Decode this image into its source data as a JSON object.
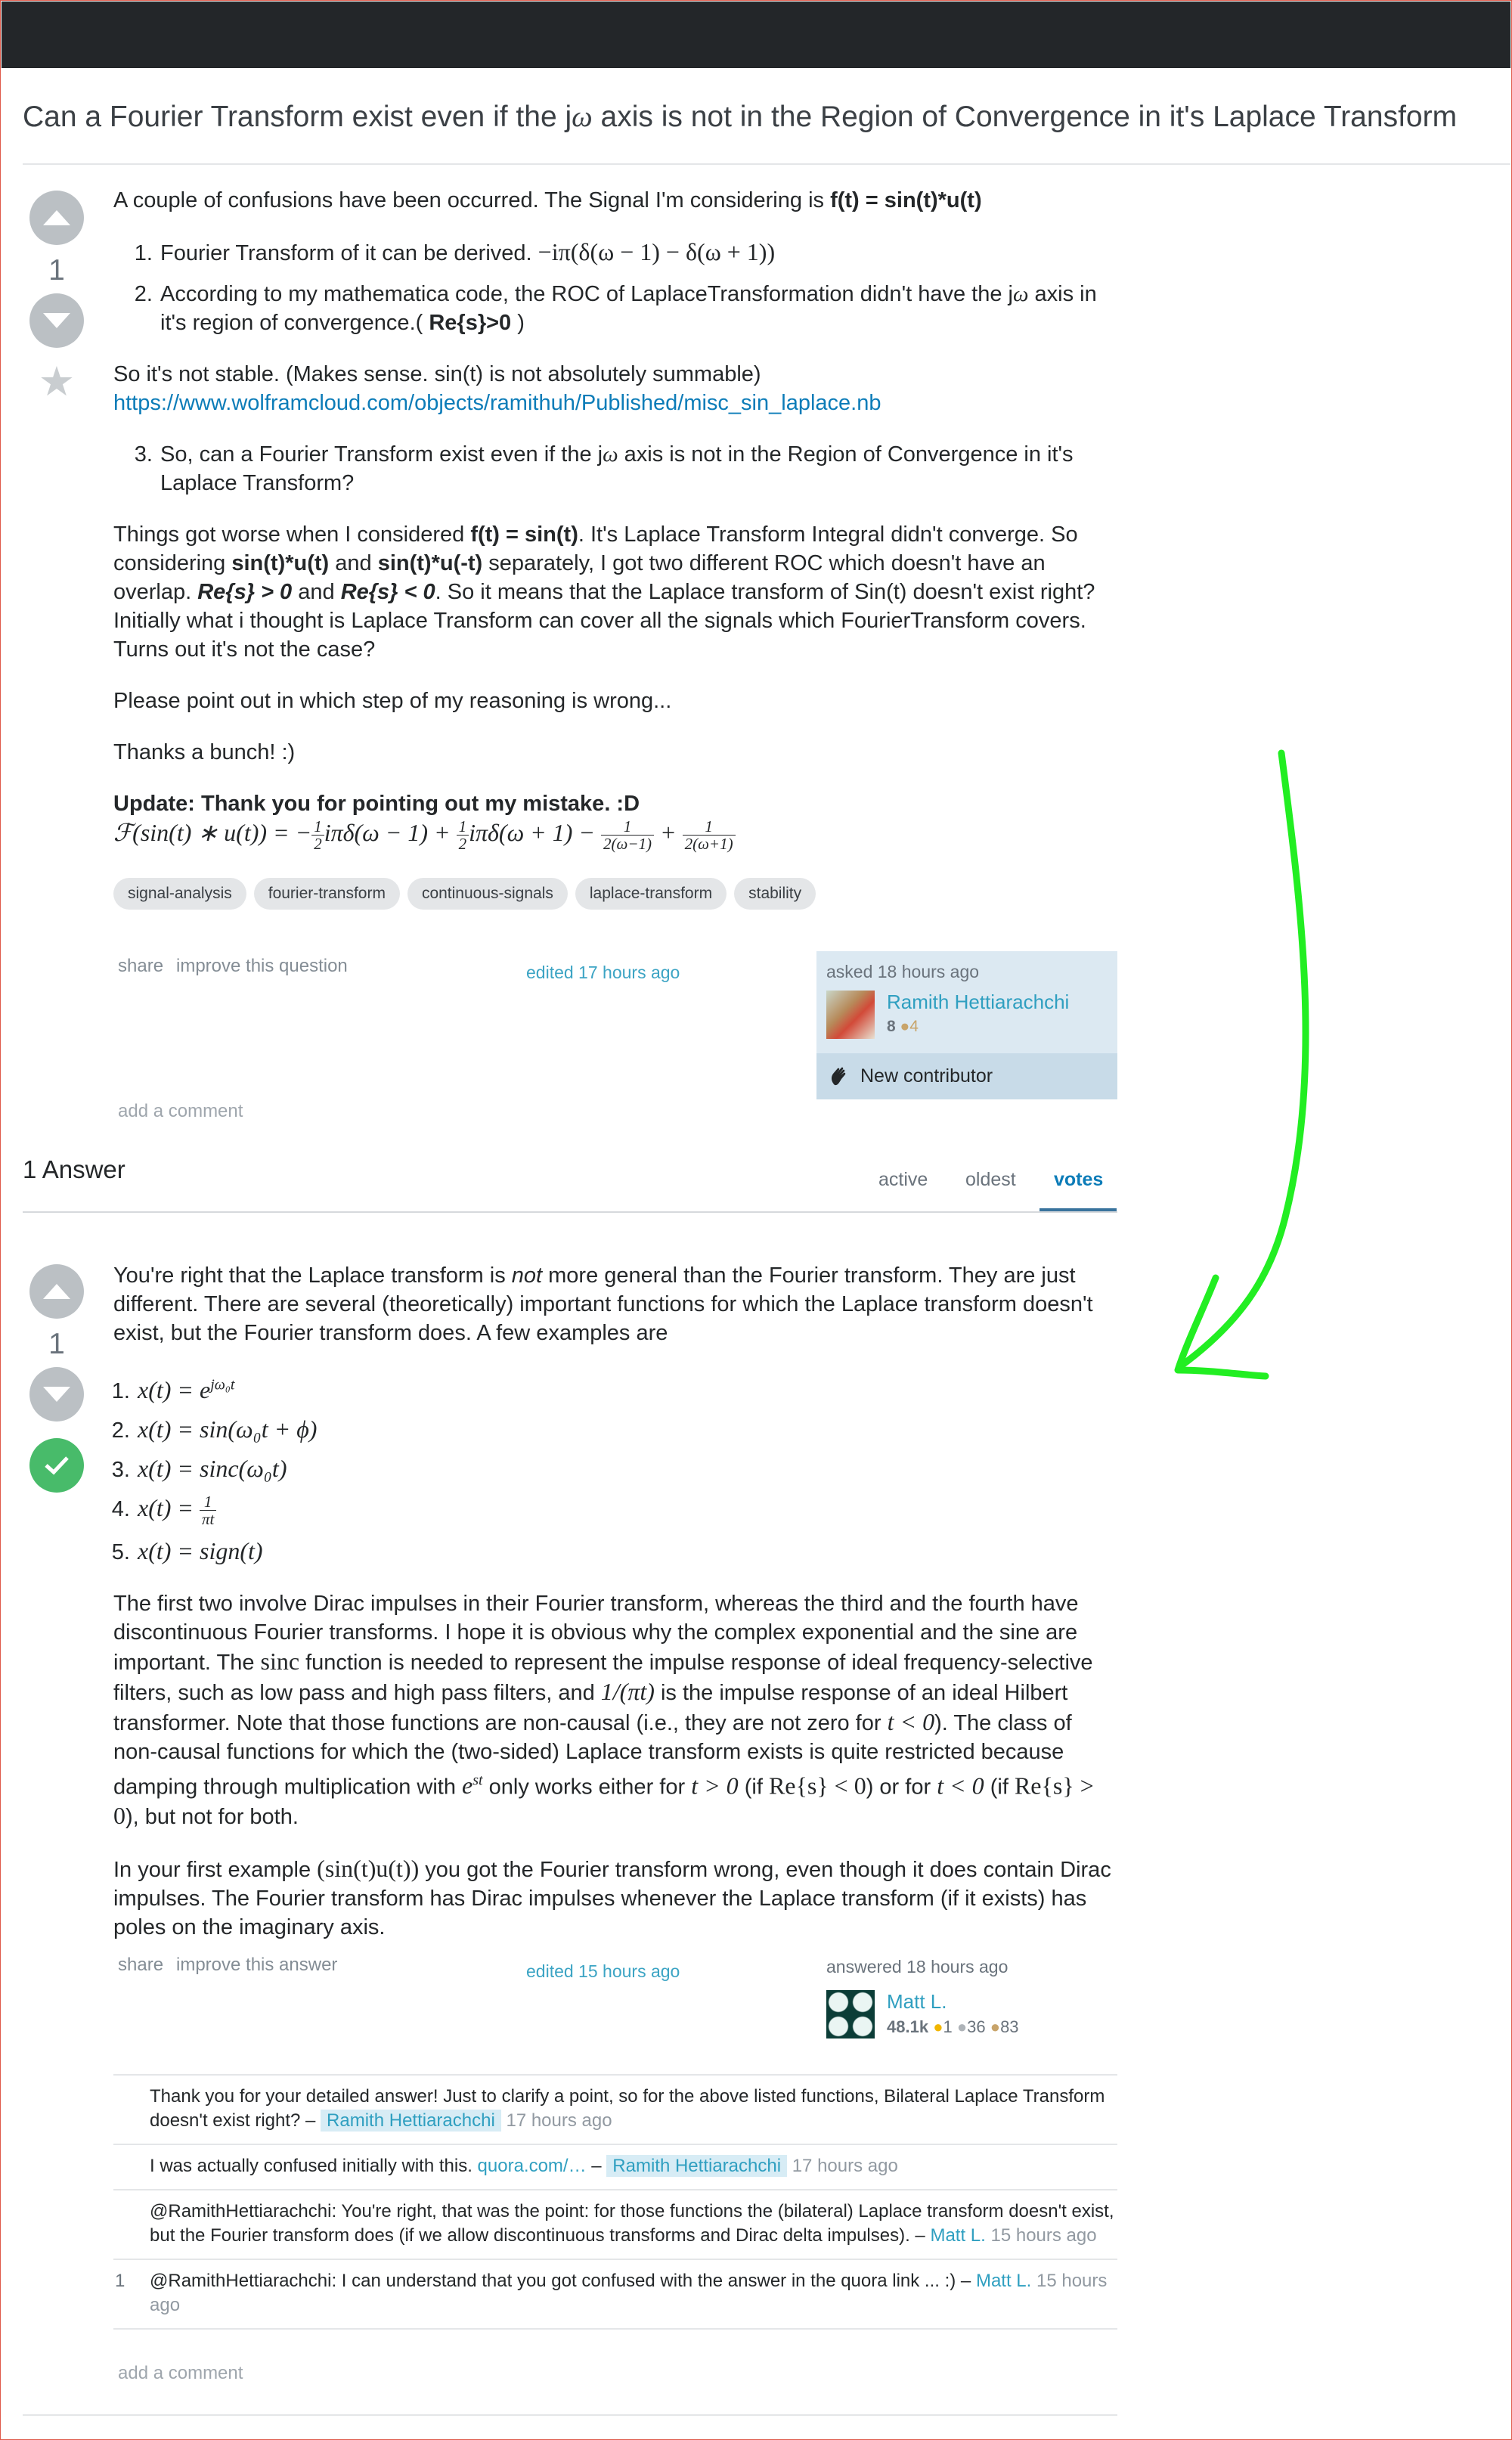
{
  "question": {
    "title_pre": "Can a Fourier Transform exist even if the j",
    "title_omega": "ω",
    "title_post": " axis is not in the Region of Convergence in it's Laplace Transform",
    "votes": "1",
    "intro_text": "A couple of confusions have been occurred. The Signal I'm considering is ",
    "intro_bold": "f(t) = sin(t)*u(t)",
    "item1_text": "Fourier Transform of it can be derived. ",
    "item1_math": "−iπ(δ(ω − 1) − δ(ω + 1))",
    "item2_a": "According to my mathematica code, the ROC of LaplaceTransformation didn't have the j",
    "item2_omega": "ω",
    "item2_b": " axis in it's region of convergence.( ",
    "item2_bold": "Re{s}>0",
    "item2_c": " )",
    "stable_text": "So it's not stable. (Makes sense. sin(t) is not absolutely summable)",
    "link": "https://www.wolframcloud.com/objects/ramithuh/Published/misc_sin_laplace.nb",
    "item3_a": "So, can a Fourier Transform exist even if the j",
    "item3_omega": "ω",
    "item3_b": " axis is not in the Region of Convergence in it's Laplace Transform?",
    "worse_1": "Things got worse when I considered ",
    "worse_b1": "f(t) = sin(t)",
    "worse_2": ". It's Laplace Transform Integral didn't converge. So considering ",
    "worse_b2": "sin(t)*u(t)",
    "worse_3": " and ",
    "worse_b3": "sin(t)*u(-t)",
    "worse_4": " separately, I got two different ROC which doesn't have an overlap. ",
    "worse_b4": "Re{s} > 0",
    "worse_5": " and ",
    "worse_b5": "Re{s} < 0",
    "worse_6": ". So it means that the Laplace transform of Sin(t) doesn't exist right? Initially what i thought is Laplace Transform can cover all the signals which FourierTransform covers. Turns out it's not the case?",
    "point_out": "Please point out in which step of my reasoning is wrong...",
    "thanks": "Thanks a bunch! :)",
    "update": "Update: Thank you for pointing out my mistake. :D",
    "update_lhs": "ℱ(sin(t) ∗ u(t)) = −",
    "update_t2": "iπδ(ω − 1) + ",
    "update_t3": "iπδ(ω + 1) − ",
    "update_t4": " + ",
    "frac_half_n": "1",
    "frac_half_d": "2",
    "frac_a_n": "1",
    "frac_a_d": "2(ω−1)",
    "frac_b_n": "1",
    "frac_b_d": "2(ω+1)",
    "tags": [
      "signal-analysis",
      "fourier-transform",
      "continuous-signals",
      "laplace-transform",
      "stability"
    ],
    "share": "share",
    "improve": "improve this question",
    "edited": "edited 17 hours ago",
    "asked": "asked 18 hours ago",
    "user": "Ramith Hettiarachchi",
    "rep": "8",
    "badge": "4",
    "new_contributor": "New contributor",
    "add_comment": "add a comment"
  },
  "answers_header": {
    "count": "1 Answer",
    "tabs": [
      "active",
      "oldest",
      "votes"
    ]
  },
  "answer": {
    "votes": "1",
    "p1_a": "You're right that the Laplace transform is ",
    "p1_em": "not",
    "p1_b": " more general than the Fourier transform. They are just different. There are several (theoretically) important functions for which the Laplace transform doesn't exist, but the Fourier transform does. A few examples are",
    "ex1": "x(t) = e",
    "ex1_sup": "jω₀t",
    "ex2": "x(t) = sin(ω₀t + ϕ)",
    "ex3": "x(t) = sinc(ω₀t)",
    "ex4": "x(t) = ",
    "ex4_n": "1",
    "ex4_d": "πt",
    "ex5": "x(t) = sign(t)",
    "p2_a": "The first two involve Dirac impulses in their Fourier transform, whereas the third and the fourth have discontinuous Fourier transforms. I hope it is obvious why the complex exponential and the sine are important. The ",
    "p2_sinc": "sinc",
    "p2_b": " function is needed to represent the impulse response of ideal frequency-selective filters, such as low pass and high pass filters, and ",
    "p2_m1": "1/(πt)",
    "p2_c": " is the impulse response of an ideal Hilbert transformer. Note that those functions are non-causal (i.e., they are not zero for ",
    "p2_m2": "t < 0",
    "p2_d": "). The class of non-causal functions for which the (two-sided) Laplace transform exists is quite restricted because damping through multiplication with ",
    "p2_m3": "e",
    "p2_m3_sup": "st",
    "p2_e": " only works either for ",
    "p2_m4": "t > 0",
    "p2_f": " (if ",
    "p2_m5": "Re{s} < 0",
    "p2_g": ") or for ",
    "p2_m6": "t < 0",
    "p2_h": " (if ",
    "p2_m7": "Re{s} > 0",
    "p2_i": "), but not for both.",
    "p3_a": "In your first example ",
    "p3_m": "(sin(t)u(t))",
    "p3_b": " you got the Fourier transform wrong, even though it does contain Dirac impulses. The Fourier transform has Dirac impulses whenever the Laplace transform (if it exists) has poles on the imaginary axis.",
    "share": "share",
    "improve": "improve this answer",
    "edited": "edited 15 hours ago",
    "answered": "answered 18 hours ago",
    "user": "Matt L.",
    "rep": "48.1k",
    "gold": "1",
    "silver": "36",
    "bronze": "83",
    "add_comment": "add a comment"
  },
  "comments": [
    {
      "score": "",
      "text": "Thank you for your detailed answer! Just to clarify a point, so for the above listed functions, Bilateral Laplace Transform doesn't exist right? – ",
      "user": "Ramith Hettiarachchi",
      "date": "17 hours ago"
    },
    {
      "score": "",
      "text": "I was actually confused initially with this. ",
      "link": "quora.com/…",
      "sep": " – ",
      "user": "Ramith Hettiarachchi",
      "date": "17 hours ago"
    },
    {
      "score": "",
      "text": "@RamithHettiarachchi: You're right, that was the point: for those functions the (bilateral) Laplace transform doesn't exist, but the Fourier transform does (if we allow discontinuous transforms and Dirac delta impulses). – ",
      "user": "Matt L.",
      "date": "15 hours ago"
    },
    {
      "score": "1",
      "text": "@RamithHettiarachchi: I can understand that you got confused with the answer in the quora link ... :) – ",
      "user": "Matt L.",
      "date": "15 hours ago"
    }
  ],
  "colors": {
    "topbar": "#232629",
    "link": "#0c7cb8",
    "accepted": "#48bb6a",
    "annotation_arrow": "#22ee22"
  },
  "icons": [
    "upvote-icon",
    "downvote-icon",
    "favorite-star-icon",
    "accepted-check-icon",
    "wave-hand-icon",
    "annotation-arrow"
  ]
}
